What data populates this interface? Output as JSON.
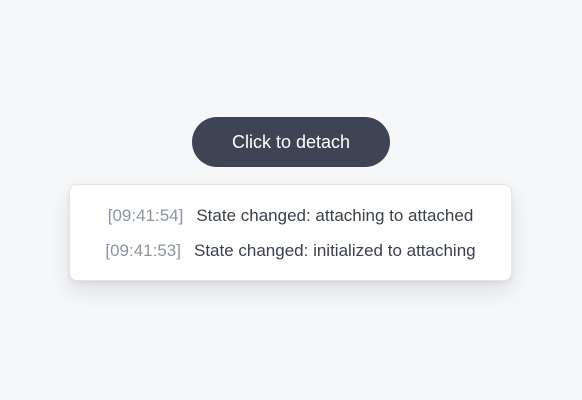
{
  "button": {
    "label": "Click to detach"
  },
  "log": {
    "entries": [
      {
        "timestamp": "[09:41:54]",
        "message": "State changed: attaching to attached"
      },
      {
        "timestamp": "[09:41:53]",
        "message": "State changed: initialized to attaching"
      }
    ]
  },
  "colors": {
    "button_bg": "#3f4454",
    "background": "#f6f7f9",
    "timestamp": "#8d93a3",
    "message": "#3a3f4d"
  }
}
